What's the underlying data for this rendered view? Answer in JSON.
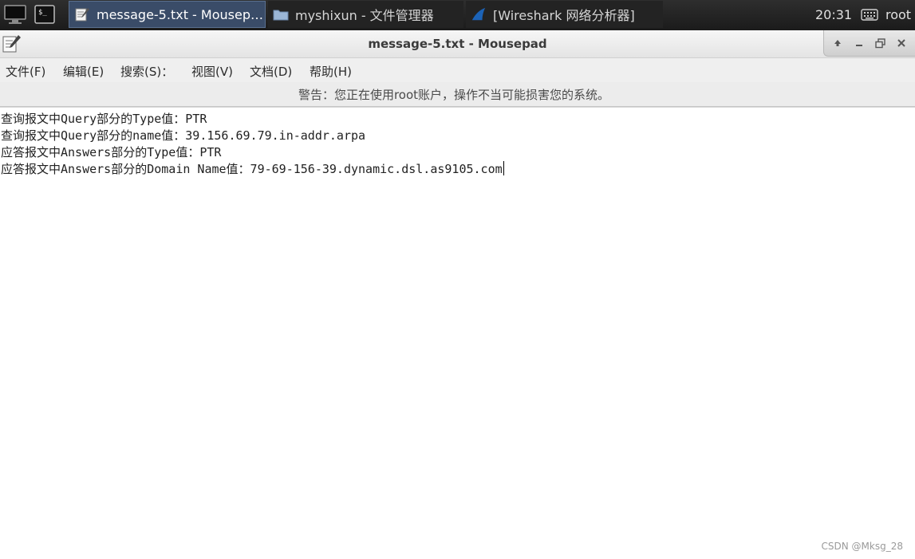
{
  "taskbar": {
    "icons": [
      "monitor-icon",
      "terminal-icon"
    ],
    "tasks": [
      {
        "label": "message-5.txt - Mousep…",
        "icon": "text-editor-icon",
        "active": true
      },
      {
        "label": "myshixun - 文件管理器",
        "icon": "folder-icon",
        "active": false
      },
      {
        "label": "[Wireshark 网络分析器]",
        "icon": "wireshark-fin-icon",
        "active": false
      }
    ],
    "clock": "20:31",
    "keyboard_icon": "keyboard-icon",
    "user": "root"
  },
  "window": {
    "title": "message-5.txt - Mousepad",
    "buttons": [
      "up-icon",
      "minimize-icon",
      "maximize-icon",
      "close-icon"
    ]
  },
  "menubar": {
    "items": [
      "文件(F)",
      "编辑(E)",
      "搜索(S)：",
      "视图(V)",
      "文档(D)",
      "帮助(H)"
    ]
  },
  "warning": "警告：您正在使用root账户，操作不当可能损害您的系统。",
  "editor": {
    "lines": [
      "查询报文中Query部分的Type值：PTR",
      "查询报文中Query部分的name值：39.156.69.79.in-addr.arpa",
      "应答报文中Answers部分的Type值：PTR",
      "应答报文中Answers部分的Domain Name值：79-69-156-39.dynamic.dsl.as9105.com"
    ]
  },
  "watermark": "CSDN @Mksg_28",
  "colors": {
    "taskbar_bg": "#1f1f1f",
    "active_task_bg": "#3a4c68",
    "window_bg": "#efefef",
    "editor_bg": "#ffffff"
  }
}
